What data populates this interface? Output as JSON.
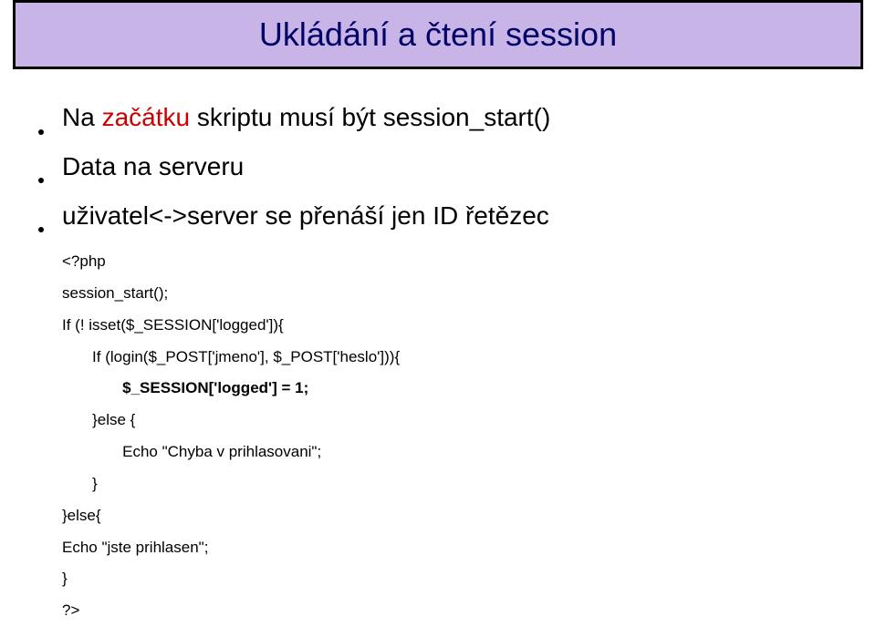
{
  "title": "Ukládání a čtení session",
  "bullets": [
    {
      "prefix": "Na ",
      "highlight": "začátku",
      "suffix": " skriptu musí být session_start()"
    },
    {
      "prefix": "Data na serveru",
      "highlight": "",
      "suffix": ""
    },
    {
      "prefix": "uživatel<->server se přenáší jen ID řetězec",
      "highlight": "",
      "suffix": ""
    }
  ],
  "code": {
    "l1": "<?php",
    "l2": "session_start();",
    "l3": "If (! isset($_SESSION['logged']){",
    "l4": "       If (login($_POST['jmeno'], $_POST['heslo'])){",
    "l5": "              $_SESSION['logged'] = 1;",
    "l6": "       }else {",
    "l7": "              Echo \"Chyba v prihlasovani\";",
    "l8": "       }",
    "l9": "}else{",
    "l10": "Echo \"jste prihlasen\";",
    "l11": "}",
    "l12": "?>"
  }
}
